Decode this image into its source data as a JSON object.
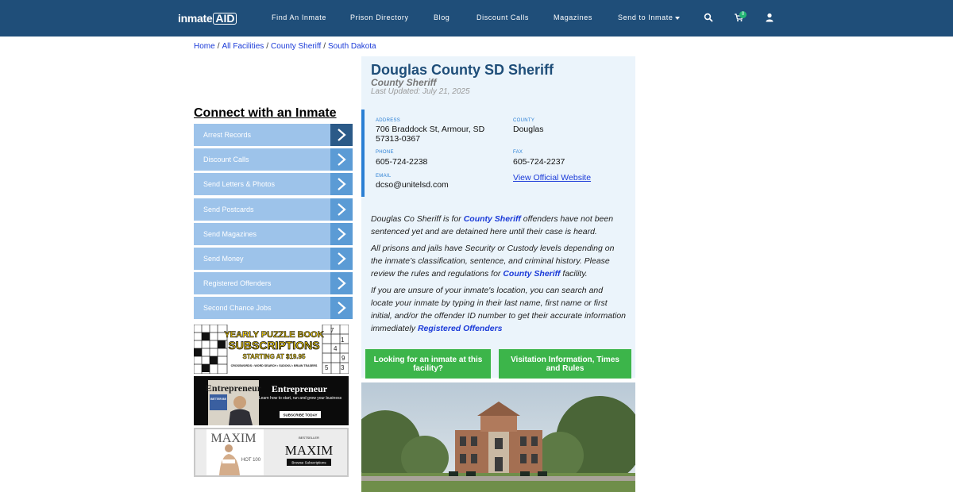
{
  "brand": {
    "logo_part1": "inmate",
    "logo_part2": "AID"
  },
  "nav": {
    "links": [
      "Find An Inmate",
      "Prison Directory",
      "Blog",
      "Discount Calls",
      "Magazines",
      "Send to Inmate"
    ],
    "cart_count": "0"
  },
  "breadcrumb": [
    "Home",
    "All Facilities",
    "County Sheriff",
    "South Dakota"
  ],
  "sidebar": {
    "title": "Connect with an Inmate",
    "items": [
      "Arrest Records",
      "Discount Calls",
      "Send Letters & Photos",
      "Send Postcards",
      "Send Magazines",
      "Send Money",
      "Registered Offenders",
      "Second Chance Jobs"
    ]
  },
  "ads": {
    "puzzle": {
      "line1": "YEARLY PUZZLE BOOK",
      "line2": "SUBSCRIPTIONS",
      "line3": "STARTING AT $19.95",
      "line4": "CROSSWORDS • WORD SEARCH • SUDOKU • BRAIN TEASERS",
      "grid_digits": [
        "7",
        "1",
        "4",
        "9",
        "3",
        "5"
      ]
    },
    "entrepreneur": {
      "cover_title": "Entrepreneur",
      "cover_sub": "BETTER BE",
      "brand": "Entrepreneur",
      "tagline": "Learn how to start, run and grow your business",
      "cta": "SUBSCRIBE TODAY"
    },
    "maxim": {
      "cover_title": "MAXIM",
      "cover_sub": "HOT 100",
      "badge": "BESTSELLER",
      "brand": "MAXIM",
      "cta": "Browse Subscriptions"
    }
  },
  "facility": {
    "name": "Douglas County SD Sheriff",
    "type": "County Sheriff",
    "updated": "Last Updated: July 21, 2025",
    "address_label": "ADDRESS",
    "address_line1": "706 Braddock St, Armour, SD",
    "address_line2": "57313-0367",
    "county_label": "COUNTY",
    "county": "Douglas",
    "phone_label": "PHONE",
    "phone": "605-724-2238",
    "fax_label": "FAX",
    "fax": "605-724-2237",
    "email_label": "EMAIL",
    "email": "dcso@unitelsd.com",
    "website_link": "View Official Website"
  },
  "description": {
    "p1_a": "Douglas Co Sheriff is for ",
    "p1_link": "County Sheriff",
    "p1_b": " offenders have not been sentenced yet and are detained here until their case is heard.",
    "p2_a": "All prisons and jails have Security or Custody levels depending on the inmate’s classification, sentence, and criminal history. Please review the rules and regulations for ",
    "p2_link": "County Sheriff",
    "p2_b": " facility.",
    "p3_a": "If you are unsure of your inmate's location, you can search and locate your inmate by typing in their last name, first name or first initial, and/or the offender ID number to get their accurate information immediately ",
    "p3_link": "Registered Offenders"
  },
  "buttons": {
    "find_inmate": "Looking for an inmate at this facility?",
    "visitation": "Visitation Information, Times and Rules"
  }
}
